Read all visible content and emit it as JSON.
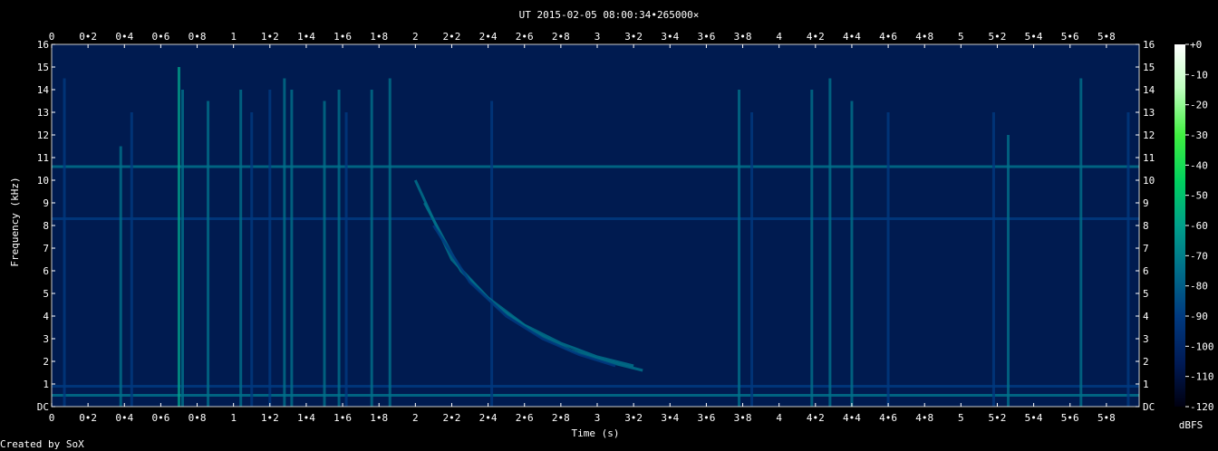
{
  "chart_data": {
    "type": "heatmap",
    "title": "UT 2015-02-05 08:00:34•265000×",
    "xlabel": "Time (s)",
    "ylabel": "Frequency (kHz)",
    "xlim": [
      0,
      5.98
    ],
    "ylim": [
      0,
      16
    ],
    "x_ticks": [
      {
        "v": 0,
        "t": "0"
      },
      {
        "v": 0.2,
        "t": "0•2"
      },
      {
        "v": 0.4,
        "t": "0•4"
      },
      {
        "v": 0.6,
        "t": "0•6"
      },
      {
        "v": 0.8,
        "t": "0•8"
      },
      {
        "v": 1,
        "t": "1"
      },
      {
        "v": 1.2,
        "t": "1•2"
      },
      {
        "v": 1.4,
        "t": "1•4"
      },
      {
        "v": 1.6,
        "t": "1•6"
      },
      {
        "v": 1.8,
        "t": "1•8"
      },
      {
        "v": 2,
        "t": "2"
      },
      {
        "v": 2.2,
        "t": "2•2"
      },
      {
        "v": 2.4,
        "t": "2•4"
      },
      {
        "v": 2.6,
        "t": "2•6"
      },
      {
        "v": 2.8,
        "t": "2•8"
      },
      {
        "v": 3,
        "t": "3"
      },
      {
        "v": 3.2,
        "t": "3•2"
      },
      {
        "v": 3.4,
        "t": "3•4"
      },
      {
        "v": 3.6,
        "t": "3•6"
      },
      {
        "v": 3.8,
        "t": "3•8"
      },
      {
        "v": 4,
        "t": "4"
      },
      {
        "v": 4.2,
        "t": "4•2"
      },
      {
        "v": 4.4,
        "t": "4•4"
      },
      {
        "v": 4.6,
        "t": "4•6"
      },
      {
        "v": 4.8,
        "t": "4•8"
      },
      {
        "v": 5,
        "t": "5"
      },
      {
        "v": 5.2,
        "t": "5•2"
      },
      {
        "v": 5.4,
        "t": "5•4"
      },
      {
        "v": 5.6,
        "t": "5•6"
      },
      {
        "v": 5.8,
        "t": "5•8"
      }
    ],
    "y_ticks": [
      {
        "v": 0,
        "t": "DC"
      },
      {
        "v": 1,
        "t": "1"
      },
      {
        "v": 2,
        "t": "2"
      },
      {
        "v": 3,
        "t": "3"
      },
      {
        "v": 4,
        "t": "4"
      },
      {
        "v": 5,
        "t": "5"
      },
      {
        "v": 6,
        "t": "6"
      },
      {
        "v": 7,
        "t": "7"
      },
      {
        "v": 8,
        "t": "8"
      },
      {
        "v": 9,
        "t": "9"
      },
      {
        "v": 10,
        "t": "10"
      },
      {
        "v": 11,
        "t": "11"
      },
      {
        "v": 12,
        "t": "12"
      },
      {
        "v": 13,
        "t": "13"
      },
      {
        "v": 14,
        "t": "14"
      },
      {
        "v": 15,
        "t": "15"
      },
      {
        "v": 16,
        "t": "16"
      }
    ],
    "colorbar": {
      "label": "dBFS",
      "range": [
        -120,
        0
      ],
      "ticks": [
        {
          "v": 0,
          "t": "+0"
        },
        {
          "v": -10,
          "t": "-10"
        },
        {
          "v": -20,
          "t": "-20"
        },
        {
          "v": -30,
          "t": "-30"
        },
        {
          "v": -40,
          "t": "-40"
        },
        {
          "v": -50,
          "t": "-50"
        },
        {
          "v": -60,
          "t": "-60"
        },
        {
          "v": -70,
          "t": "-70"
        },
        {
          "v": -80,
          "t": "-80"
        },
        {
          "v": -90,
          "t": "-90"
        },
        {
          "v": -100,
          "t": "-100"
        },
        {
          "v": -110,
          "t": "-110"
        },
        {
          "v": -120,
          "t": "-120"
        }
      ],
      "colors": [
        "#000010",
        "#001a55",
        "#003a80",
        "#00708a",
        "#00a08a",
        "#00d060",
        "#40f040",
        "#c0ffc0",
        "#ffffff"
      ]
    },
    "background_level_dBFS": -105,
    "horizontal_lines": [
      {
        "freq_khz": 10.6,
        "level_dBFS": -80
      },
      {
        "freq_khz": 0.5,
        "level_dBFS": -70
      },
      {
        "freq_khz": 0.9,
        "level_dBFS": -85
      },
      {
        "freq_khz": 8.3,
        "level_dBFS": -95
      }
    ],
    "transients": [
      {
        "t": 0.07,
        "fmax": 14.5,
        "level_dBFS": -85
      },
      {
        "t": 0.38,
        "fmax": 11.5,
        "level_dBFS": -80
      },
      {
        "t": 0.44,
        "fmax": 13,
        "level_dBFS": -90
      },
      {
        "t": 0.7,
        "fmax": 15,
        "level_dBFS": -60
      },
      {
        "t": 0.72,
        "fmax": 14,
        "level_dBFS": -70
      },
      {
        "t": 0.86,
        "fmax": 13.5,
        "level_dBFS": -80
      },
      {
        "t": 1.04,
        "fmax": 14,
        "level_dBFS": -80
      },
      {
        "t": 1.1,
        "fmax": 13,
        "level_dBFS": -85
      },
      {
        "t": 1.2,
        "fmax": 14,
        "level_dBFS": -85
      },
      {
        "t": 1.28,
        "fmax": 14.5,
        "level_dBFS": -70
      },
      {
        "t": 1.32,
        "fmax": 14,
        "level_dBFS": -75
      },
      {
        "t": 1.5,
        "fmax": 13.5,
        "level_dBFS": -80
      },
      {
        "t": 1.58,
        "fmax": 14,
        "level_dBFS": -75
      },
      {
        "t": 1.62,
        "fmax": 13,
        "level_dBFS": -85
      },
      {
        "t": 1.76,
        "fmax": 14,
        "level_dBFS": -70
      },
      {
        "t": 1.86,
        "fmax": 14.5,
        "level_dBFS": -75
      },
      {
        "t": 2.42,
        "fmax": 13.5,
        "level_dBFS": -85
      },
      {
        "t": 3.78,
        "fmax": 14,
        "level_dBFS": -80
      },
      {
        "t": 3.85,
        "fmax": 13,
        "level_dBFS": -85
      },
      {
        "t": 4.18,
        "fmax": 14,
        "level_dBFS": -80
      },
      {
        "t": 4.28,
        "fmax": 14.5,
        "level_dBFS": -75
      },
      {
        "t": 4.4,
        "fmax": 13.5,
        "level_dBFS": -80
      },
      {
        "t": 4.6,
        "fmax": 13,
        "level_dBFS": -85
      },
      {
        "t": 5.18,
        "fmax": 13,
        "level_dBFS": -85
      },
      {
        "t": 5.26,
        "fmax": 12,
        "level_dBFS": -80
      },
      {
        "t": 5.66,
        "fmax": 14.5,
        "level_dBFS": -70
      },
      {
        "t": 5.92,
        "fmax": 13,
        "level_dBFS": -85
      }
    ],
    "tweek_curves": [
      {
        "t": [
          2.0,
          2.2,
          2.4,
          2.6,
          2.8,
          3.0,
          3.2
        ],
        "f": [
          10,
          6.5,
          4.8,
          3.6,
          2.8,
          2.2,
          1.8
        ],
        "level_dBFS": -80
      },
      {
        "t": [
          2.05,
          2.25,
          2.45,
          2.65,
          2.85,
          3.05,
          3.25
        ],
        "f": [
          9,
          6,
          4.4,
          3.3,
          2.5,
          2.0,
          1.6
        ],
        "level_dBFS": -82
      },
      {
        "t": [
          2.1,
          2.3,
          2.5,
          2.7,
          2.9,
          3.1
        ],
        "f": [
          8,
          5.5,
          4.0,
          3.0,
          2.3,
          1.8
        ],
        "level_dBFS": -85
      }
    ]
  },
  "footer": {
    "credit": "Created by SoX"
  }
}
